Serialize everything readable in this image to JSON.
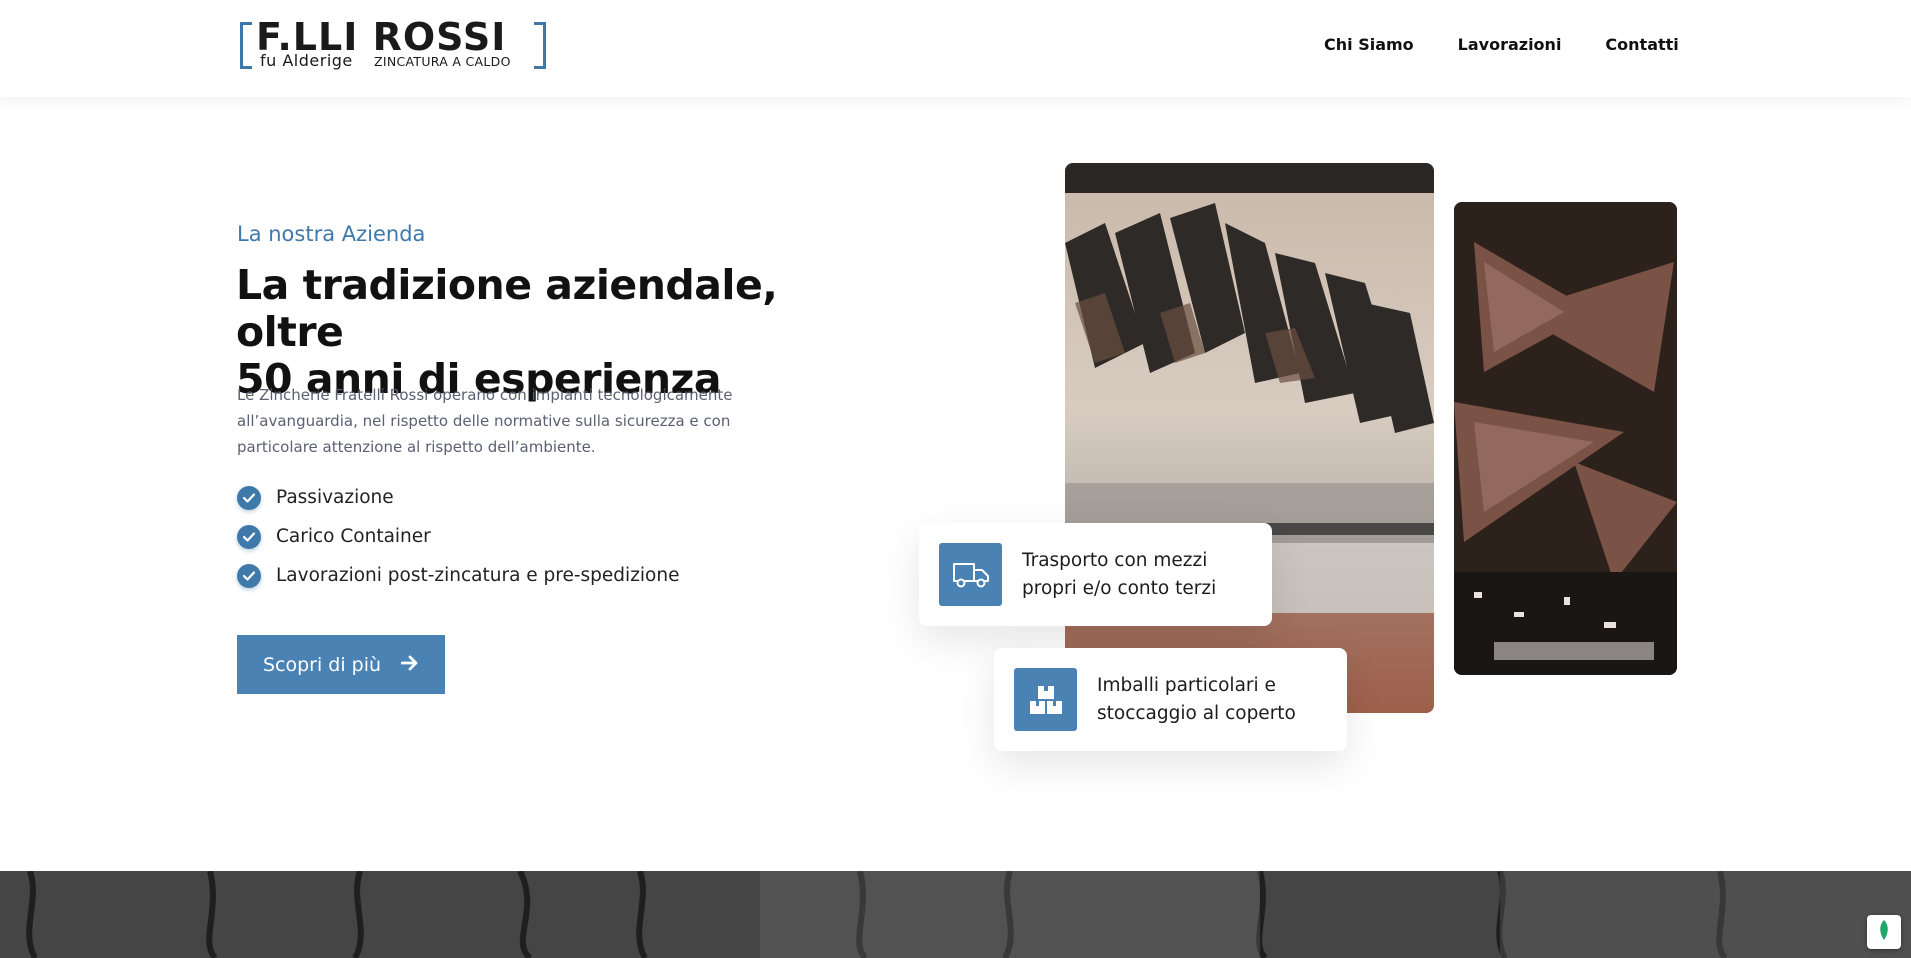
{
  "header": {
    "logo": {
      "name": "F.LLI ROSSI",
      "tagline_left": "fu Alderige",
      "tagline_right": "ZINCATURA A CALDO"
    },
    "nav": [
      {
        "label": "Chi Siamo",
        "icon": "none"
      },
      {
        "label": "Lavorazioni",
        "icon": "none"
      },
      {
        "label": "Contatti",
        "icon": "none"
      }
    ]
  },
  "hero": {
    "eyebrow": "La nostra Azienda",
    "headline_line1": "La tradizione aziendale, oltre",
    "headline_line2": "50 anni di esperienza",
    "description": "Le Zincherie Fratelli Rossi operano con impianti tecnologicamente all’avanguardia, nel rispetto delle normative sulla sicurezza e con particolare attenzione al rispetto dell’ambiente.",
    "checklist": [
      "Passivazione",
      "Carico Container",
      "Lavorazioni post-zincatura e pre-spedizione"
    ],
    "cta_label": "Scopri di più",
    "cta_icon": "arrow-right-icon"
  },
  "features": [
    {
      "icon": "truck-icon",
      "line1": "Trasporto con mezzi",
      "line2": "propri e/o conto terzi"
    },
    {
      "icon": "boxes-icon",
      "line1": "Imballi particolari e",
      "line2": "stoccaggio al coperto"
    }
  ],
  "colors": {
    "accent": "#3f79aa",
    "button": "#4a82b3",
    "text": "#111111",
    "muted": "#5b6072"
  }
}
